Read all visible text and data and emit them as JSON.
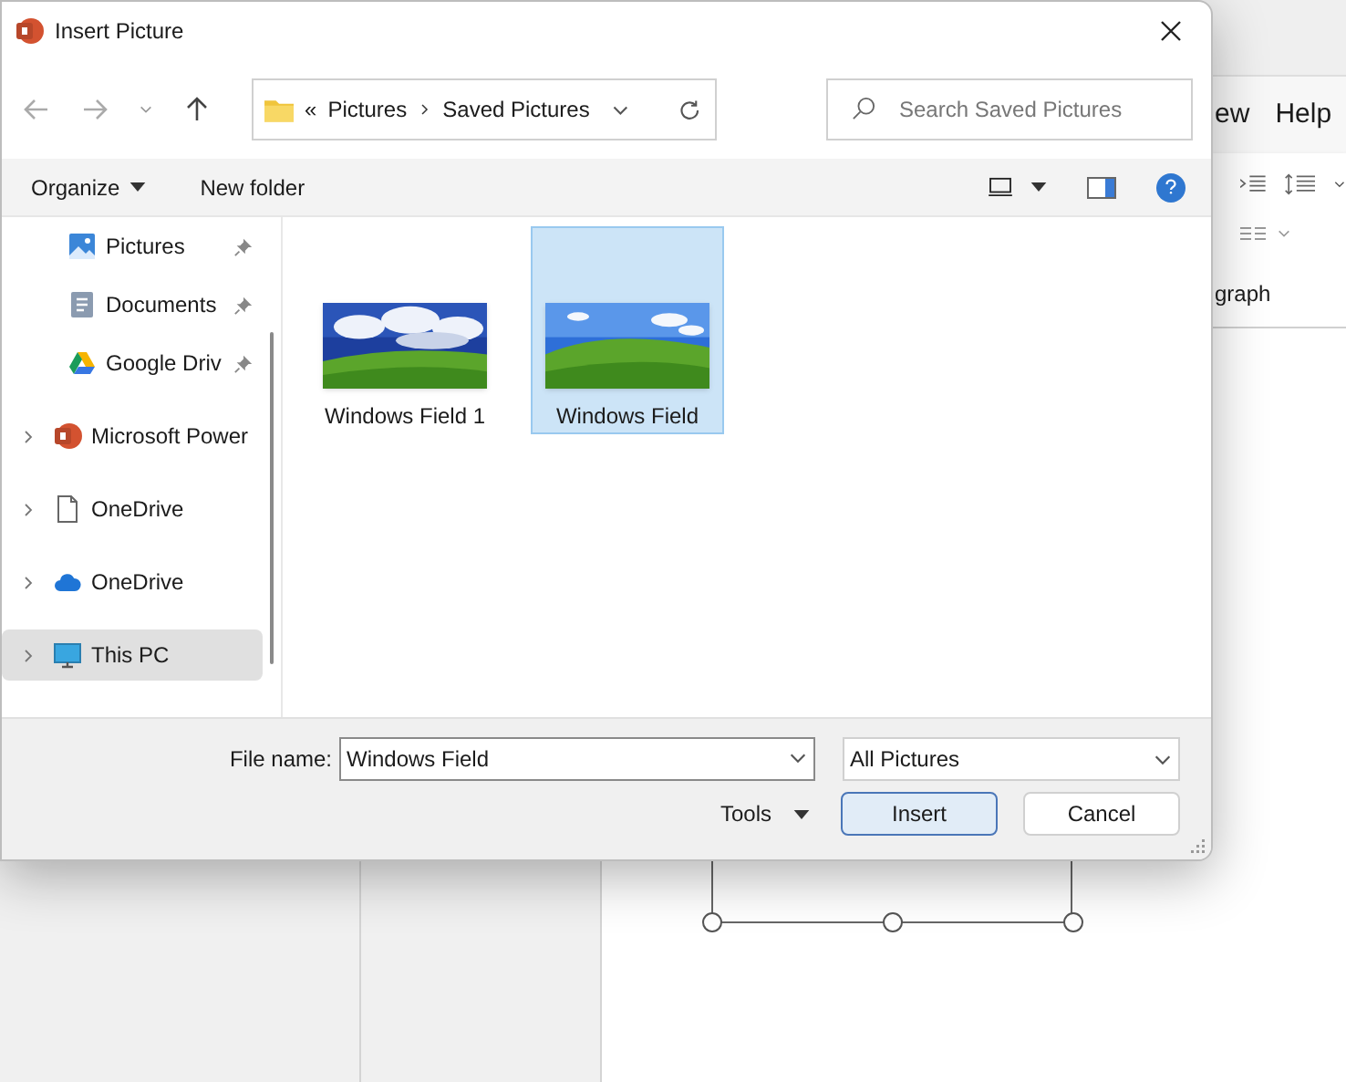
{
  "background": {
    "ribbon_tabs": [
      {
        "label": "ew",
        "selected": false
      },
      {
        "label": "Help",
        "selected": false
      }
    ],
    "group_label": "graph"
  },
  "window": {
    "title": "Insert Picture"
  },
  "address_bar": {
    "overflow": "«",
    "path": [
      "Pictures",
      "Saved Pictures"
    ]
  },
  "search": {
    "placeholder": "Search Saved Pictures"
  },
  "toolbar": {
    "organize": "Organize",
    "new_folder": "New folder"
  },
  "sidebar": {
    "items": [
      {
        "label": "Pictures",
        "kind": "pictures",
        "pinned": true,
        "expandable": false,
        "selected": false
      },
      {
        "label": "Documents",
        "kind": "documents",
        "pinned": true,
        "expandable": false,
        "selected": false
      },
      {
        "label": "Google Driv",
        "kind": "drive",
        "pinned": true,
        "expandable": false,
        "selected": false
      },
      {
        "label": "Microsoft Power",
        "kind": "app",
        "pinned": false,
        "expandable": true,
        "selected": false
      },
      {
        "label": "OneDrive",
        "kind": "file",
        "pinned": false,
        "expandable": true,
        "selected": false
      },
      {
        "label": "OneDrive",
        "kind": "cloud",
        "pinned": false,
        "expandable": true,
        "selected": false
      },
      {
        "label": "This PC",
        "kind": "pc",
        "pinned": false,
        "expandable": true,
        "selected": true
      }
    ]
  },
  "files": [
    {
      "name": "Windows Field 1",
      "kind": "picture",
      "selected": false
    },
    {
      "name": "Windows Field",
      "kind": "picture",
      "selected": true
    }
  ],
  "footer": {
    "file_name_label": "File name:",
    "file_name": "Windows Field",
    "filter": "All Pictures",
    "tools": "Tools",
    "insert": "Insert",
    "cancel": "Cancel"
  }
}
